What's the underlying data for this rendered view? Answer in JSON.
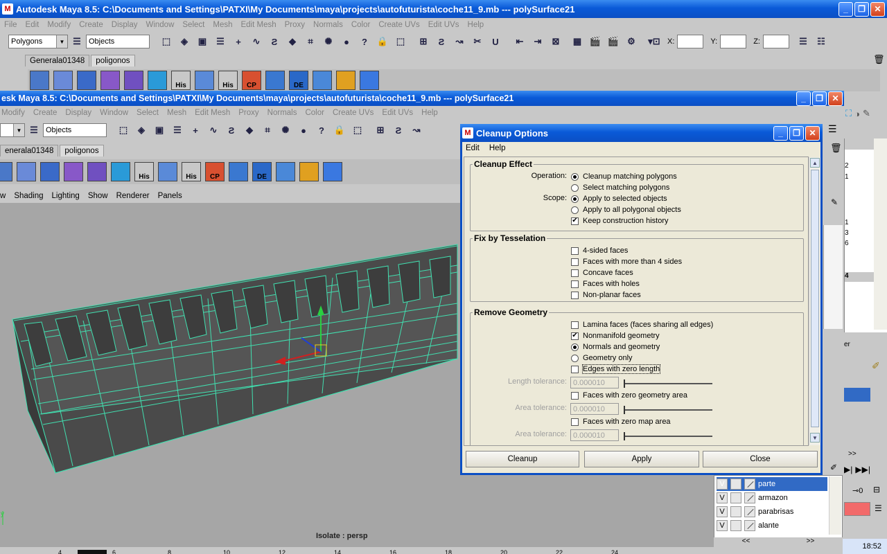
{
  "main_window": {
    "title": "Autodesk Maya 8.5: C:\\Documents and Settings\\PATXI\\My Documents\\maya\\projects\\autofuturista\\coche11_9.mb   ---   polySurface21",
    "menu": [
      "File",
      "Edit",
      "Modify",
      "Create",
      "Display",
      "Window",
      "Select",
      "Mesh",
      "Edit Mesh",
      "Proxy",
      "Normals",
      "Color",
      "Create UVs",
      "Edit UVs",
      "Help"
    ],
    "mode_select": "Polygons",
    "objects_field": "Objects",
    "x_label": "X:",
    "y_label": "Y:",
    "z_label": "Z:",
    "shelf_tabs": [
      "Generala01348",
      "poligonos"
    ],
    "shelf_labels": [
      "His",
      "His",
      "CP",
      "DE"
    ]
  },
  "second_window": {
    "title": "esk Maya 8.5: C:\\Documents and Settings\\PATXI\\My Documents\\maya\\projects\\autofuturista\\coche11_9.mb   ---   polySurface21",
    "menu": [
      "Modify",
      "Create",
      "Display",
      "Window",
      "Select",
      "Mesh",
      "Edit Mesh",
      "Proxy",
      "Normals",
      "Color",
      "Create UVs",
      "Edit UVs",
      "Help"
    ],
    "objects_field": "Objects",
    "shelf_tabs": [
      "enerala01348",
      "poligonos"
    ],
    "shelf_labels": [
      "His",
      "His",
      "CP",
      "DE"
    ],
    "panel_menu": [
      "w",
      "Shading",
      "Lighting",
      "Show",
      "Renderer",
      "Panels"
    ],
    "viewport_label": "Isolate : persp",
    "timeline_ticks": [
      "4",
      "6",
      "8",
      "10",
      "12",
      "14",
      "16",
      "18",
      "20",
      "22",
      "24"
    ]
  },
  "dialog": {
    "title": "Cleanup Options",
    "menu": [
      "Edit",
      "Help"
    ],
    "cleanup_effect": {
      "title": "Cleanup Effect",
      "operation_label": "Operation:",
      "operation_options": [
        {
          "label": "Cleanup matching polygons",
          "selected": true
        },
        {
          "label": "Select matching polygons",
          "selected": false
        }
      ],
      "scope_label": "Scope:",
      "scope_options": [
        {
          "label": "Apply to selected objects",
          "selected": true
        },
        {
          "label": "Apply to all polygonal objects",
          "selected": false
        }
      ],
      "keep_history": {
        "label": "Keep construction history",
        "checked": true
      }
    },
    "fix_tesselation": {
      "title": "Fix by Tesselation",
      "options": [
        {
          "label": "4-sided faces",
          "checked": false
        },
        {
          "label": "Faces with more than 4 sides",
          "checked": false
        },
        {
          "label": "Concave faces",
          "checked": false
        },
        {
          "label": "Faces with holes",
          "checked": false
        },
        {
          "label": "Non-planar faces",
          "checked": false
        }
      ]
    },
    "remove_geometry": {
      "title": "Remove Geometry",
      "lamina": {
        "label": "Lamina faces (faces sharing all edges)",
        "checked": false
      },
      "nonmanifold": {
        "label": "Nonmanifold geometry",
        "checked": true
      },
      "normals_geom": {
        "label": "Normals and geometry",
        "selected": true
      },
      "geom_only": {
        "label": "Geometry only",
        "selected": false
      },
      "zero_edges": {
        "label": "Edges with zero length",
        "checked": false
      },
      "length_tol_label": "Length tolerance:",
      "length_tol": "0.000010",
      "zero_area": {
        "label": "Faces with zero geometry area",
        "checked": false
      },
      "area_tol_label": "Area tolerance:",
      "area_tol": "0.000010",
      "zero_map": {
        "label": "Faces with zero map area",
        "checked": false
      },
      "map_tol_label": "Area tolerance:",
      "map_tol": "0.000010"
    },
    "buttons": {
      "cleanup": "Cleanup",
      "apply": "Apply",
      "close": "Close"
    }
  },
  "side_panel": {
    "numbers": [
      "2",
      "1",
      "1",
      "3",
      "6",
      "4"
    ],
    "partial_label": "er"
  },
  "layers": {
    "rows": [
      {
        "v": "V",
        "name": "parte",
        "selected": true
      },
      {
        "v": "V",
        "name": "armazon",
        "selected": false
      },
      {
        "v": "V",
        "name": "parabrisas",
        "selected": false
      },
      {
        "v": "V",
        "name": "alante",
        "selected": false
      }
    ],
    "nav_left": "<<",
    "nav_right": ">>",
    "arrows": ">>",
    "key_value": "⊸0"
  },
  "taskbar": {
    "time": "18:52"
  },
  "colors": {
    "accent": "#0b4fc4",
    "wire": "#41e0b0",
    "selection": "#316ac5",
    "layer_color": "#f26a6a"
  }
}
